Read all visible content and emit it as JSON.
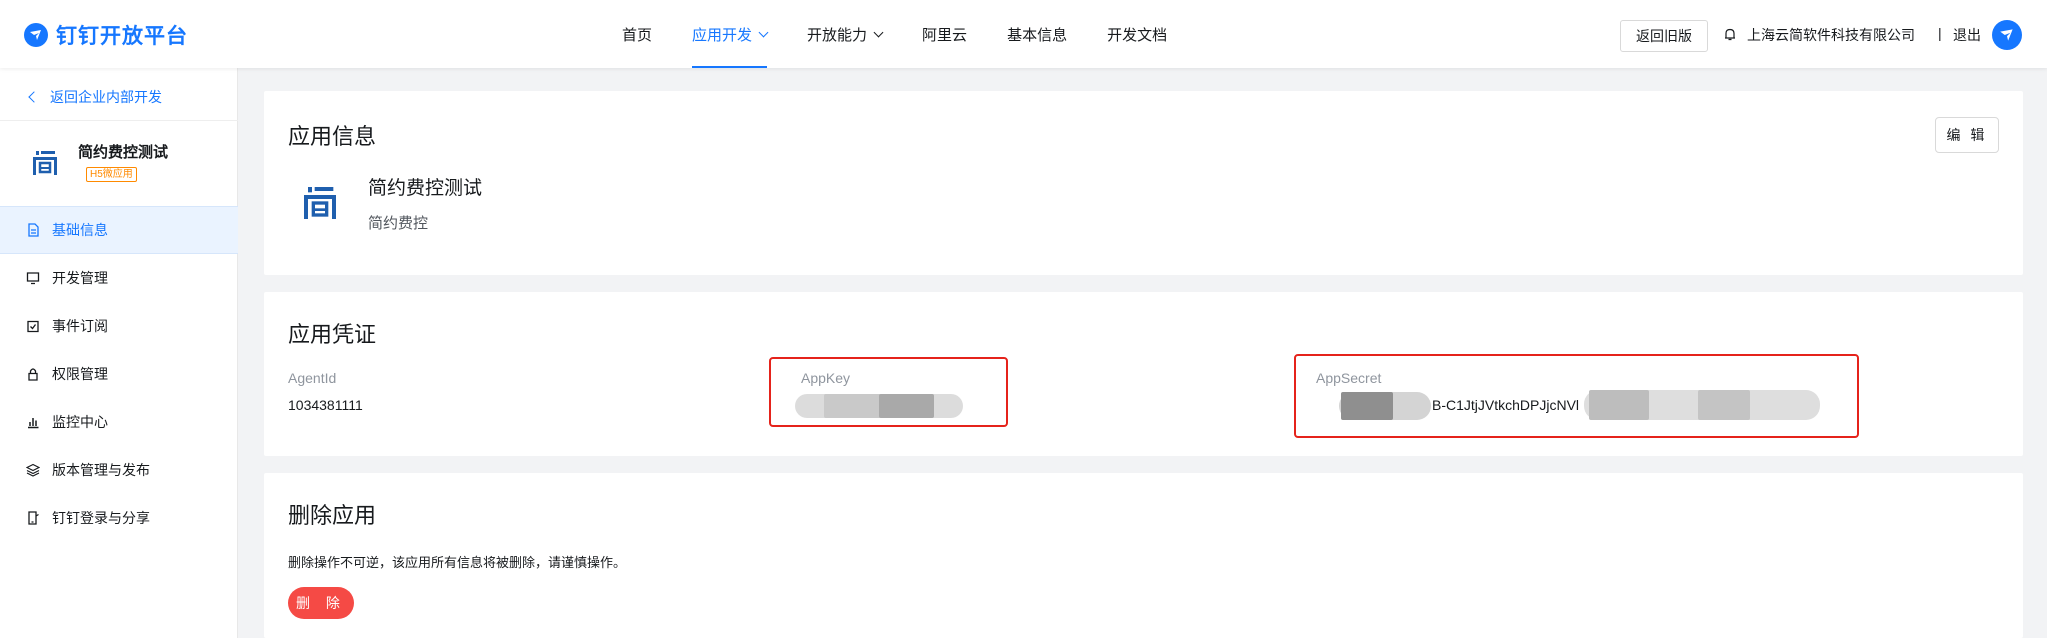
{
  "topbar": {
    "logo_text": "钉钉开放平台",
    "nav": [
      {
        "label": "首页",
        "dropdown": false,
        "active": false
      },
      {
        "label": "应用开发",
        "dropdown": true,
        "active": true
      },
      {
        "label": "开放能力",
        "dropdown": true,
        "active": false
      },
      {
        "label": "阿里云",
        "dropdown": false,
        "active": false
      },
      {
        "label": "基本信息",
        "dropdown": false,
        "active": false
      },
      {
        "label": "开发文档",
        "dropdown": false,
        "active": false
      }
    ],
    "old_version_label": "返回旧版",
    "company": "上海云简软件科技有限公司",
    "separator": "|",
    "logout_label": "退出",
    "accent_color": "#1677ff"
  },
  "sidebar": {
    "back_label": "返回企业内部开发",
    "app_name": "简约费控测试",
    "app_badge": "H5微应用",
    "items": [
      {
        "label": "基础信息",
        "icon": "document-icon",
        "active": true
      },
      {
        "label": "开发管理",
        "icon": "monitor-icon",
        "active": false
      },
      {
        "label": "事件订阅",
        "icon": "calendar-check-icon",
        "active": false
      },
      {
        "label": "权限管理",
        "icon": "lock-icon",
        "active": false
      },
      {
        "label": "监控中心",
        "icon": "bar-chart-icon",
        "active": false
      },
      {
        "label": "版本管理与发布",
        "icon": "layers-icon",
        "active": false
      },
      {
        "label": "钉钉登录与分享",
        "icon": "phone-share-icon",
        "active": false
      }
    ]
  },
  "app_info": {
    "title": "应用信息",
    "edit_label": "编 辑",
    "app_name": "简约费控测试",
    "app_desc": "简约费控"
  },
  "credentials": {
    "title": "应用凭证",
    "agent_id_label": "AgentId",
    "agent_id_value": "1034381111",
    "app_key_label": "AppKey",
    "app_secret_label": "AppSecret",
    "app_secret_visible_fragment": "B-C1JtjJVtkchDPJjcNVl",
    "highlight_color": "#e5231b"
  },
  "delete_app": {
    "title": "删除应用",
    "warning": "删除操作不可逆，该应用所有信息将被删除，请谨慎操作。",
    "delete_label": "删 除",
    "danger_color": "#f54a45"
  }
}
